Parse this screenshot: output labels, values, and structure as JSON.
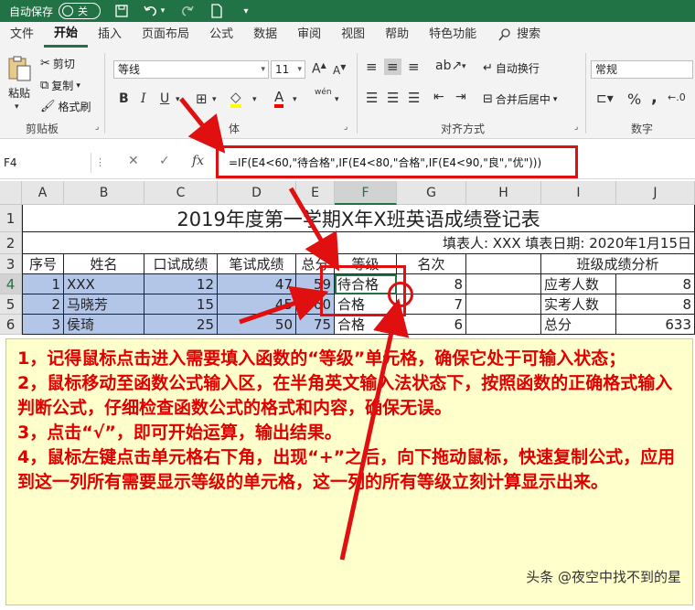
{
  "titlebar": {
    "autosave": "自动保存",
    "toggle": "关"
  },
  "tabs": [
    "文件",
    "开始",
    "插入",
    "页面布局",
    "公式",
    "数据",
    "审阅",
    "视图",
    "帮助",
    "特色功能",
    "搜索"
  ],
  "ribbon": {
    "paste": "粘贴",
    "cut": "剪切",
    "copy": "复制",
    "format_painter": "格式刷",
    "clipboard_label": "剪贴板",
    "font_name": "等线",
    "font_size": "11",
    "font_label": "体",
    "bold": "B",
    "italic": "I",
    "underline": "U",
    "wen": "wén",
    "wrap_text": "自动换行",
    "merge_center": "合并后居中",
    "alignment_label": "对齐方式",
    "number_format": "常规",
    "number_label": "数字",
    "percent": "%"
  },
  "formula_bar": {
    "name_box": "F4",
    "fx": "fx",
    "formula": "=IF(E4<60,\"待合格\",IF(E4<80,\"合格\",IF(E4<90,\"良\",\"优\")))"
  },
  "grid": {
    "columns": [
      "A",
      "B",
      "C",
      "D",
      "E",
      "F",
      "G",
      "H",
      "I",
      "J"
    ],
    "rows": [
      "1",
      "2",
      "3",
      "4",
      "5",
      "6"
    ],
    "title": "2019年度第一学期X年X班英语成绩登记表",
    "filled_by": "填表人:  XXX   填表日期:  2020年1月15日",
    "headers": [
      "序号",
      "姓名",
      "口试成绩",
      "笔试成绩",
      "总分",
      "等级",
      "名次",
      "班级成绩分析"
    ],
    "data_rows": [
      {
        "no": "1",
        "name": "XXX",
        "oral": "12",
        "written": "47",
        "total": "59",
        "grade": "待合格",
        "rank": "8",
        "stat_label": "应考人数",
        "stat_value": "8"
      },
      {
        "no": "2",
        "name": "马晓芳",
        "oral": "15",
        "written": "45",
        "total": "60",
        "grade": "合格",
        "rank": "7",
        "stat_label": "实考人数",
        "stat_value": "8"
      },
      {
        "no": "3",
        "name": "侯琦",
        "oral": "25",
        "written": "50",
        "total": "75",
        "grade": "合格",
        "rank": "6",
        "stat_label": "总分",
        "stat_value": "633"
      }
    ]
  },
  "note": {
    "lines": [
      "1，记得鼠标点击进入需要填入函数的“等级”单元格，确保它处于可输入状态；",
      "2，鼠标移动至函数公式输入区，在半角英文输入法状态下，按照函数的正确格式输入判断公式，仔细检查函数公式的格式和内容，确保无误。",
      "3，点击“√”，即可开始运算，输出结果。",
      "4，鼠标左键点击单元格右下角，出现“+”之后，向下拖动鼠标，快速复制公式，应用到这一列所有需要显示等级的单元格，这一列的所有等级立刻计算显示出来。"
    ],
    "watermark": "头条 @夜空中找不到的星"
  },
  "colors": {
    "excel_green": "#217346",
    "highlight": "#b4c6e7",
    "annotation_red": "#e01010",
    "note_bg": "#ffffcc"
  }
}
